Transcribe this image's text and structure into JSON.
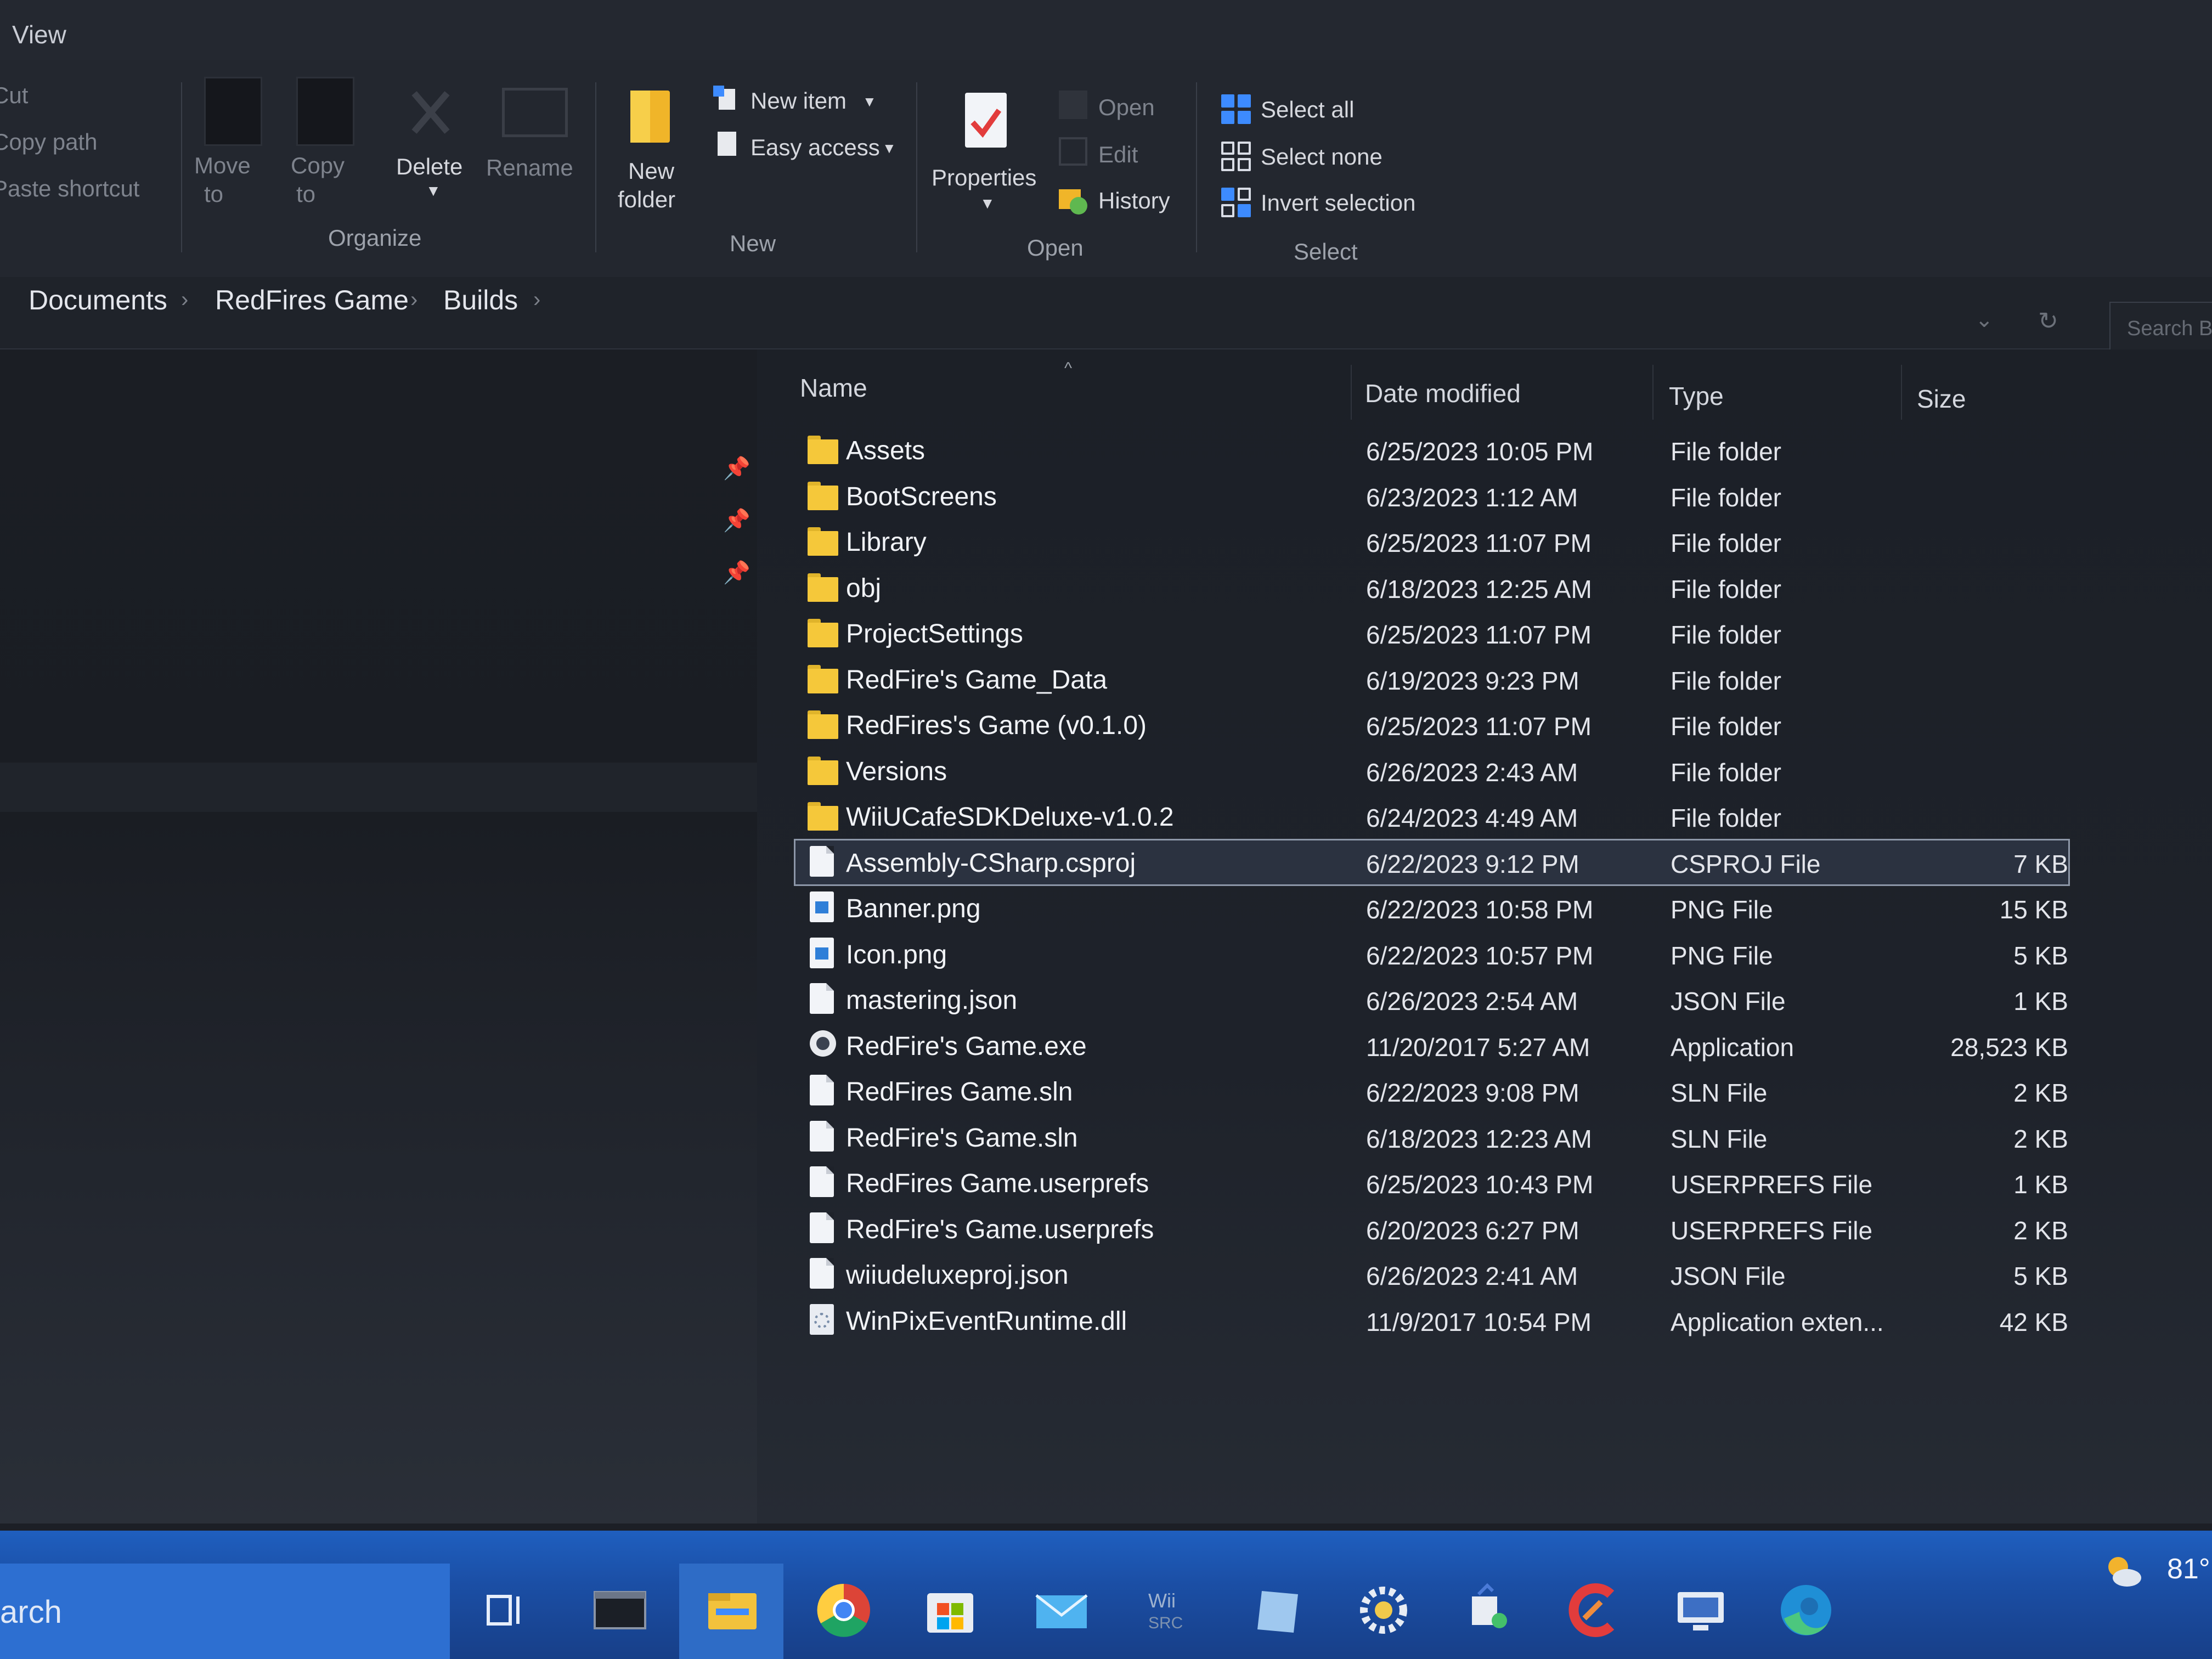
{
  "ribbon": {
    "tab_view": "View",
    "clipboard": {
      "cut": "Cut",
      "copy_path": "Copy path",
      "paste_shortcut": "Paste shortcut"
    },
    "organize": {
      "move_to_line1": "Move",
      "move_to_line2": "to",
      "copy_to_line1": "Copy",
      "copy_to_line2": "to",
      "delete": "Delete",
      "rename": "Rename",
      "label": "Organize"
    },
    "new": {
      "new_folder_line1": "New",
      "new_folder_line2": "folder",
      "new_item": "New item",
      "easy_access": "Easy access",
      "label": "New"
    },
    "open": {
      "properties": "Properties",
      "open": "Open",
      "edit": "Edit",
      "history": "History",
      "label": "Open"
    },
    "select": {
      "select_all": "Select all",
      "select_none": "Select none",
      "invert_selection": "Invert selection",
      "label": "Select"
    }
  },
  "breadcrumb": [
    "Documents",
    "RedFires Game",
    "Builds"
  ],
  "search_placeholder": "Search B",
  "columns": {
    "name": "Name",
    "date": "Date modified",
    "type": "Type",
    "size": "Size"
  },
  "files": [
    {
      "name": "Assets",
      "date": "6/25/2023 10:05 PM",
      "type": "File folder",
      "size": "",
      "icon": "folder-icon"
    },
    {
      "name": "BootScreens",
      "date": "6/23/2023 1:12 AM",
      "type": "File folder",
      "size": "",
      "icon": "folder-icon"
    },
    {
      "name": "Library",
      "date": "6/25/2023 11:07 PM",
      "type": "File folder",
      "size": "",
      "icon": "folder-icon"
    },
    {
      "name": "obj",
      "date": "6/18/2023 12:25 AM",
      "type": "File folder",
      "size": "",
      "icon": "folder-icon"
    },
    {
      "name": "ProjectSettings",
      "date": "6/25/2023 11:07 PM",
      "type": "File folder",
      "size": "",
      "icon": "folder-icon"
    },
    {
      "name": "RedFire's Game_Data",
      "date": "6/19/2023 9:23 PM",
      "type": "File folder",
      "size": "",
      "icon": "folder-icon"
    },
    {
      "name": "RedFires's Game (v0.1.0)",
      "date": "6/25/2023 11:07 PM",
      "type": "File folder",
      "size": "",
      "icon": "folder-icon"
    },
    {
      "name": "Versions",
      "date": "6/26/2023 2:43 AM",
      "type": "File folder",
      "size": "",
      "icon": "folder-icon"
    },
    {
      "name": "WiiUCafeSDKDeluxe-v1.0.2",
      "date": "6/24/2023 4:49 AM",
      "type": "File folder",
      "size": "",
      "icon": "folder-icon"
    },
    {
      "name": "Assembly-CSharp.csproj",
      "date": "6/22/2023 9:12 PM",
      "type": "CSPROJ File",
      "size": "7 KB",
      "icon": "file-icon",
      "selected": true
    },
    {
      "name": "Banner.png",
      "date": "6/22/2023 10:58 PM",
      "type": "PNG File",
      "size": "15 KB",
      "icon": "image-file-icon"
    },
    {
      "name": "Icon.png",
      "date": "6/22/2023 10:57 PM",
      "type": "PNG File",
      "size": "5 KB",
      "icon": "image-file-icon"
    },
    {
      "name": "mastering.json",
      "date": "6/26/2023 2:54 AM",
      "type": "JSON File",
      "size": "1 KB",
      "icon": "file-icon"
    },
    {
      "name": "RedFire's Game.exe",
      "date": "11/20/2017 5:27 AM",
      "type": "Application",
      "size": "28,523 KB",
      "icon": "exe-icon"
    },
    {
      "name": "RedFires Game.sln",
      "date": "6/22/2023 9:08 PM",
      "type": "SLN File",
      "size": "2 KB",
      "icon": "file-icon"
    },
    {
      "name": "RedFire's Game.sln",
      "date": "6/18/2023 12:23 AM",
      "type": "SLN File",
      "size": "2 KB",
      "icon": "file-icon"
    },
    {
      "name": "RedFires Game.userprefs",
      "date": "6/25/2023 10:43 PM",
      "type": "USERPREFS File",
      "size": "1 KB",
      "icon": "file-icon"
    },
    {
      "name": "RedFire's Game.userprefs",
      "date": "6/20/2023 6:27 PM",
      "type": "USERPREFS File",
      "size": "2 KB",
      "icon": "file-icon"
    },
    {
      "name": "wiiudeluxeproj.json",
      "date": "6/26/2023 2:41 AM",
      "type": "JSON File",
      "size": "5 KB",
      "icon": "file-icon"
    },
    {
      "name": "WinPixEventRuntime.dll",
      "date": "11/9/2017 10:54 PM",
      "type": "Application exten...",
      "size": "42 KB",
      "icon": "dll-icon"
    }
  ],
  "taskbar": {
    "search_text": "arch",
    "temperature": "81°",
    "icons": [
      "task-view-icon",
      "terminal-icon",
      "file-explorer-icon",
      "chrome-icon",
      "store-icon",
      "mail-icon",
      "wii-icon",
      "notepad-icon",
      "settings-icon",
      "snipping-tool-icon",
      "ccleaner-icon",
      "remote-desktop-icon",
      "edge-icon"
    ]
  },
  "colors": {
    "accent": "#3d8bff",
    "folder": "#f5c83a",
    "taskbar": "#1b4fa6",
    "background": "#1c1f26"
  }
}
